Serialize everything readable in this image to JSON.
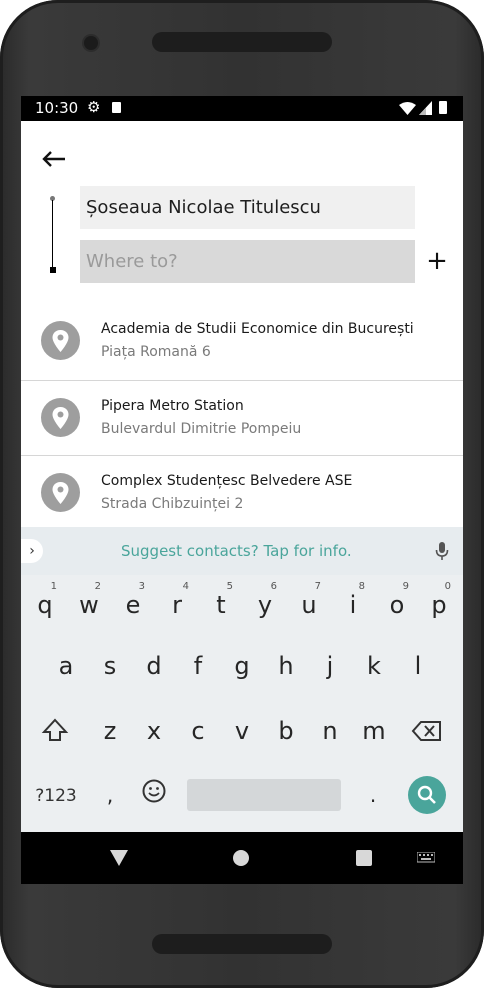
{
  "status_bar": {
    "time": "10:30",
    "gear_icon": "gear-icon",
    "sd_icon": "sd-card-icon",
    "wifi_icon": "wifi-icon",
    "signal_icon": "cell-signal-icon",
    "battery_icon": "battery-icon"
  },
  "header": {
    "back_icon": "arrow-left-icon"
  },
  "route": {
    "from_value": "Șoseaua Nicolae Titulescu",
    "to_placeholder": "Where to?",
    "add_icon": "plus-icon",
    "add_label": "+"
  },
  "results": [
    {
      "title": "Academia de Studii Economice din București",
      "subtitle": "Piața Romană 6",
      "icon": "location-pin-icon"
    },
    {
      "title": "Pipera Metro Station",
      "subtitle": "Bulevardul Dimitrie Pompeiu",
      "icon": "location-pin-icon"
    },
    {
      "title": "Complex Studențesc Belvedere ASE",
      "subtitle": "Strada Chibzuinței 2",
      "icon": "location-pin-icon"
    }
  ],
  "keyboard": {
    "suggestion_text": "Suggest contacts? Tap for info.",
    "expand_label": "›",
    "row1": [
      "q",
      "w",
      "e",
      "r",
      "t",
      "y",
      "u",
      "i",
      "o",
      "p"
    ],
    "row1_hints": [
      "1",
      "2",
      "3",
      "4",
      "5",
      "6",
      "7",
      "8",
      "9",
      "0"
    ],
    "row2": [
      "a",
      "s",
      "d",
      "f",
      "g",
      "h",
      "j",
      "k",
      "l"
    ],
    "row3": [
      "z",
      "x",
      "c",
      "v",
      "b",
      "n",
      "m"
    ],
    "symbols_label": "?123",
    "comma_label": ",",
    "period_label": ".",
    "accent_color": "#4aa59b"
  },
  "nav_bar": {
    "back_icon": "nav-back-triangle-icon",
    "home_icon": "nav-home-circle-icon",
    "recents_icon": "nav-recents-square-icon",
    "keyboard_icon": "keyboard-switch-icon"
  }
}
